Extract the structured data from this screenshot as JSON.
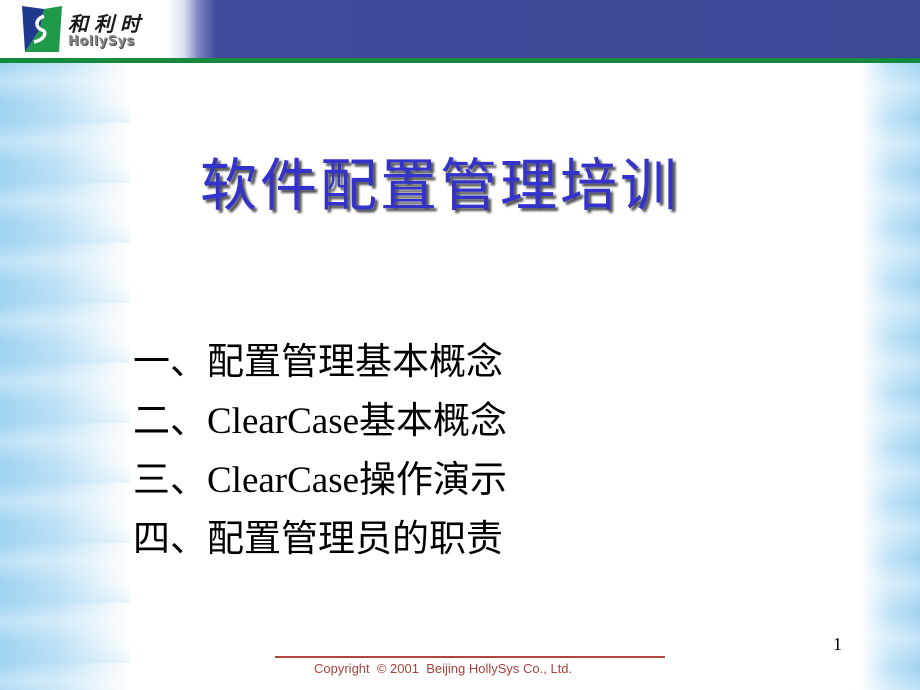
{
  "header": {
    "logo_cn": "和利时",
    "logo_en": "HollySys",
    "colors": {
      "banner": "#3d4897",
      "rule": "#118a3e"
    }
  },
  "slide": {
    "title": "软件配置管理培训",
    "title_color": "#3333cc",
    "agenda": [
      "一、配置管理基本概念",
      "二、ClearCase基本概念",
      "三、ClearCase操作演示",
      "四、配置管理员的职责"
    ],
    "page_number": "1"
  },
  "footer": {
    "copyright": "Copyright  © 2001  Beijing HollySys Co., Ltd.",
    "color": "#a8423a"
  }
}
